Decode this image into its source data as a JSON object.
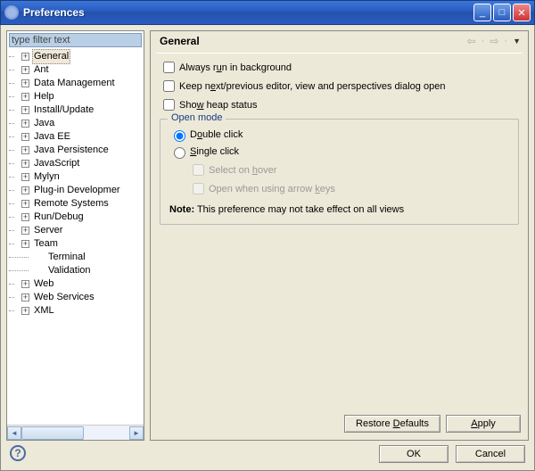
{
  "window": {
    "title": "Preferences"
  },
  "filter": {
    "placeholder": "type filter text"
  },
  "tree": {
    "items": [
      {
        "label": "General",
        "exp": "+",
        "selected": true
      },
      {
        "label": "Ant",
        "exp": "+"
      },
      {
        "label": "Data Management",
        "exp": "+"
      },
      {
        "label": "Help",
        "exp": "+"
      },
      {
        "label": "Install/Update",
        "exp": "+"
      },
      {
        "label": "Java",
        "exp": "+"
      },
      {
        "label": "Java EE",
        "exp": "+"
      },
      {
        "label": "Java Persistence",
        "exp": "+"
      },
      {
        "label": "JavaScript",
        "exp": "+"
      },
      {
        "label": "Mylyn",
        "exp": "+"
      },
      {
        "label": "Plug-in Developmer",
        "exp": "+"
      },
      {
        "label": "Remote Systems",
        "exp": "+"
      },
      {
        "label": "Run/Debug",
        "exp": "+"
      },
      {
        "label": "Server",
        "exp": "+"
      },
      {
        "label": "Team",
        "exp": "+"
      },
      {
        "label": "Terminal",
        "exp": "",
        "leaf": true,
        "indent": true
      },
      {
        "label": "Validation",
        "exp": "",
        "leaf": true,
        "indent": true
      },
      {
        "label": "Web",
        "exp": "+"
      },
      {
        "label": "Web Services",
        "exp": "+"
      },
      {
        "label": "XML",
        "exp": "+"
      }
    ]
  },
  "page": {
    "title": "General",
    "chk_run_bg": "Always run in background",
    "chk_keep_prev": "Keep next/previous editor, view and perspectives dialog open",
    "chk_heap": "Show heap status",
    "group_title": "Open mode",
    "radio_double": "Double click",
    "radio_single": "Single click",
    "sub_hover": "Select on hover",
    "sub_arrow": "Open when using arrow keys",
    "note_label": "Note:",
    "note_text": " This preference may not take effect on all views",
    "restore": "Restore Defaults",
    "apply": "Apply"
  },
  "dialog": {
    "ok": "OK",
    "cancel": "Cancel"
  }
}
